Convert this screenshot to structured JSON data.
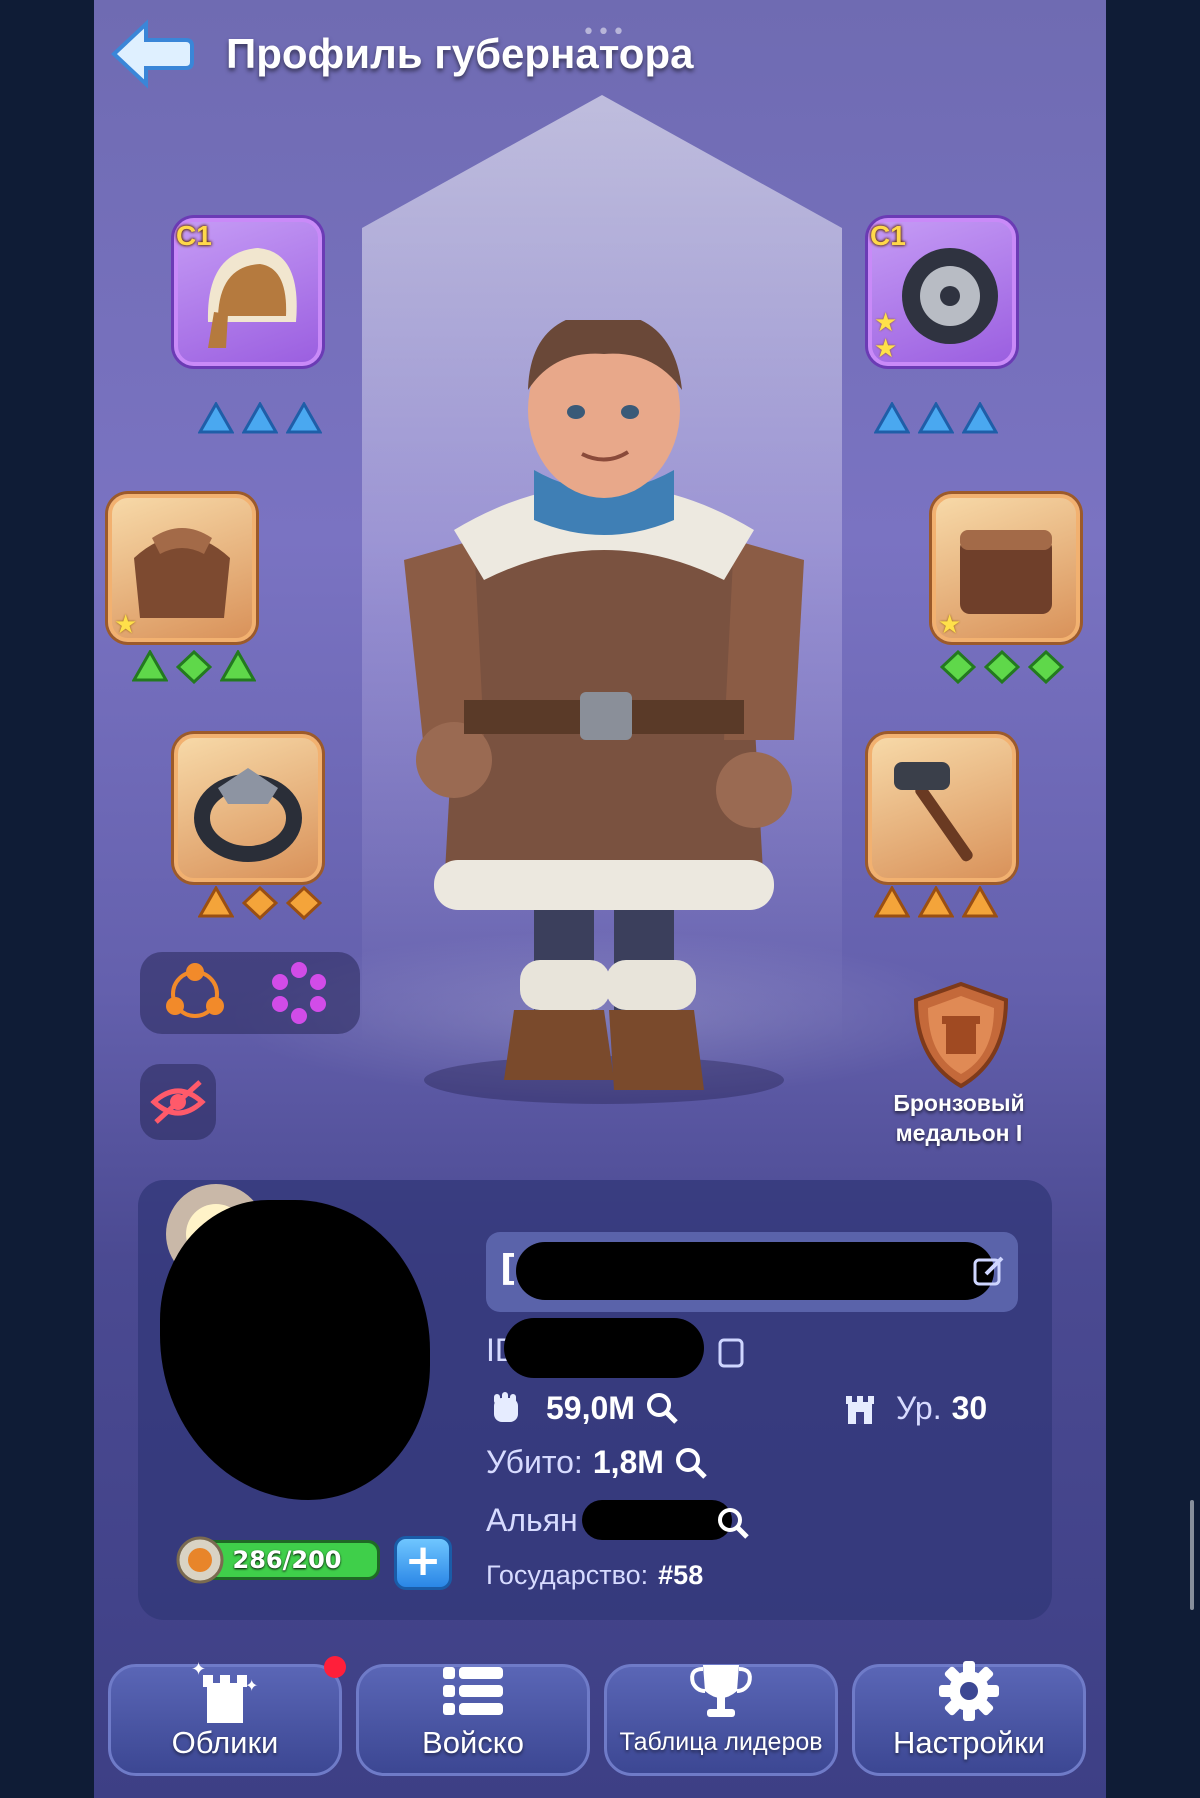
{
  "header": {
    "title": "Профиль губернатора",
    "grabber": "•••"
  },
  "equipment": {
    "slots": [
      {
        "id": "hat",
        "tier_label": "C1",
        "rarity": "purple",
        "stars": 0,
        "gem_color": "blue"
      },
      {
        "id": "wheel",
        "tier_label": "C1",
        "rarity": "purple",
        "stars": 2,
        "gem_color": "blue"
      },
      {
        "id": "coat",
        "tier_label": "",
        "rarity": "orange",
        "stars": 1,
        "gem_color": "green"
      },
      {
        "id": "pants",
        "tier_label": "",
        "rarity": "orange",
        "stars": 1,
        "gem_color": "green"
      },
      {
        "id": "ring",
        "tier_label": "",
        "rarity": "orange",
        "stars": 0,
        "gem_color": "orange"
      },
      {
        "id": "tool",
        "tier_label": "",
        "rarity": "orange",
        "stars": 0,
        "gem_color": "orange"
      }
    ]
  },
  "medal": {
    "label": "Бронзовый медальон I"
  },
  "profile": {
    "name_prefix": "[",
    "id_label": "ID",
    "power_value": "59,0M",
    "level_label": "Ур.",
    "level_value": "30",
    "killed_label": "Убито:",
    "killed_value": "1,8M",
    "alliance_label": "Альян",
    "state_label": "Государство:",
    "state_value": "#58",
    "fuel_text": "286/200",
    "fuel_fraction": 1.0,
    "plus_label": "+"
  },
  "nav": {
    "skins_label": "Облики",
    "army_label": "Войско",
    "leaderboard_label": "Таблица лидеров",
    "settings_label": "Настройки"
  },
  "colors": {
    "accent_blue": "#2a86e6",
    "fuel_green": "#2fae3a",
    "notification_red": "#ff1f3a",
    "medal_bronze": "#c4693a"
  }
}
